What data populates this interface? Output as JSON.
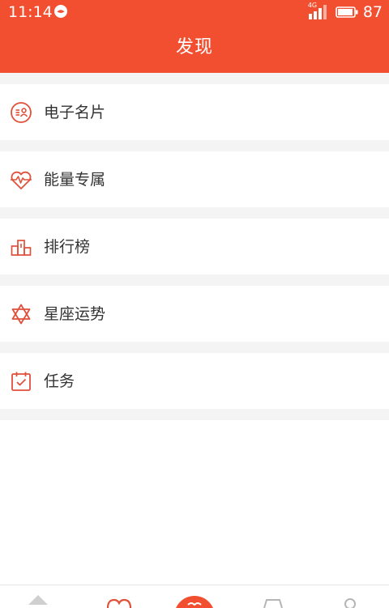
{
  "statusbar": {
    "time": "11:14",
    "network": "4G",
    "battery": "87"
  },
  "header": {
    "title": "发现"
  },
  "menu": [
    {
      "label": "电子名片",
      "icon": "business-card-icon"
    },
    {
      "label": "能量专属",
      "icon": "heartbeat-icon"
    },
    {
      "label": "排行榜",
      "icon": "podium-icon"
    },
    {
      "label": "星座运势",
      "icon": "star-of-david-icon"
    },
    {
      "label": "任务",
      "icon": "calendar-check-icon"
    }
  ],
  "bottom_nav": [
    {
      "icon": "home-icon"
    },
    {
      "icon": "heart-icon"
    },
    {
      "icon": "center-action-icon"
    },
    {
      "icon": "shopping-bag-icon"
    },
    {
      "icon": "profile-icon"
    }
  ],
  "colors": {
    "accent": "#f24f31",
    "icon": "#e0503a",
    "text": "#333333",
    "background_gap": "#f4f4f4"
  }
}
